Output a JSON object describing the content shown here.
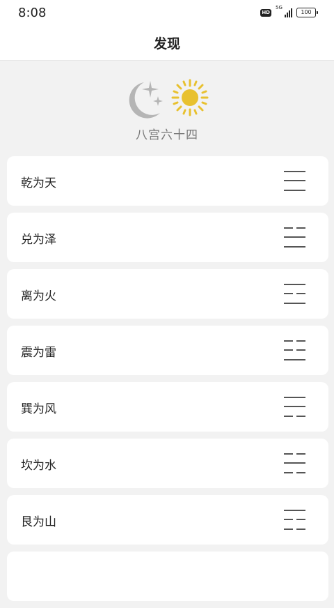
{
  "status_bar": {
    "time": "8:08",
    "hd_label": "HD",
    "network_label": "5G",
    "signal_bars": 4,
    "battery_label": "100"
  },
  "header": {
    "title": "发现"
  },
  "hero": {
    "icon": "moon-sun-icon",
    "moon_color": "#b5b5b5",
    "sun_color": "#e8c12f",
    "title": "八宫六十四"
  },
  "list": {
    "items": [
      {
        "label": "乾为天",
        "trigram": [
          1,
          1,
          1
        ]
      },
      {
        "label": "兑为泽",
        "trigram": [
          0,
          1,
          1
        ]
      },
      {
        "label": "离为火",
        "trigram": [
          1,
          0,
          1
        ]
      },
      {
        "label": "震为雷",
        "trigram": [
          0,
          0,
          1
        ]
      },
      {
        "label": "巽为风",
        "trigram": [
          1,
          1,
          0
        ]
      },
      {
        "label": "坎为水",
        "trigram": [
          0,
          1,
          0
        ]
      },
      {
        "label": "艮为山",
        "trigram": [
          1,
          0,
          0
        ]
      }
    ]
  }
}
